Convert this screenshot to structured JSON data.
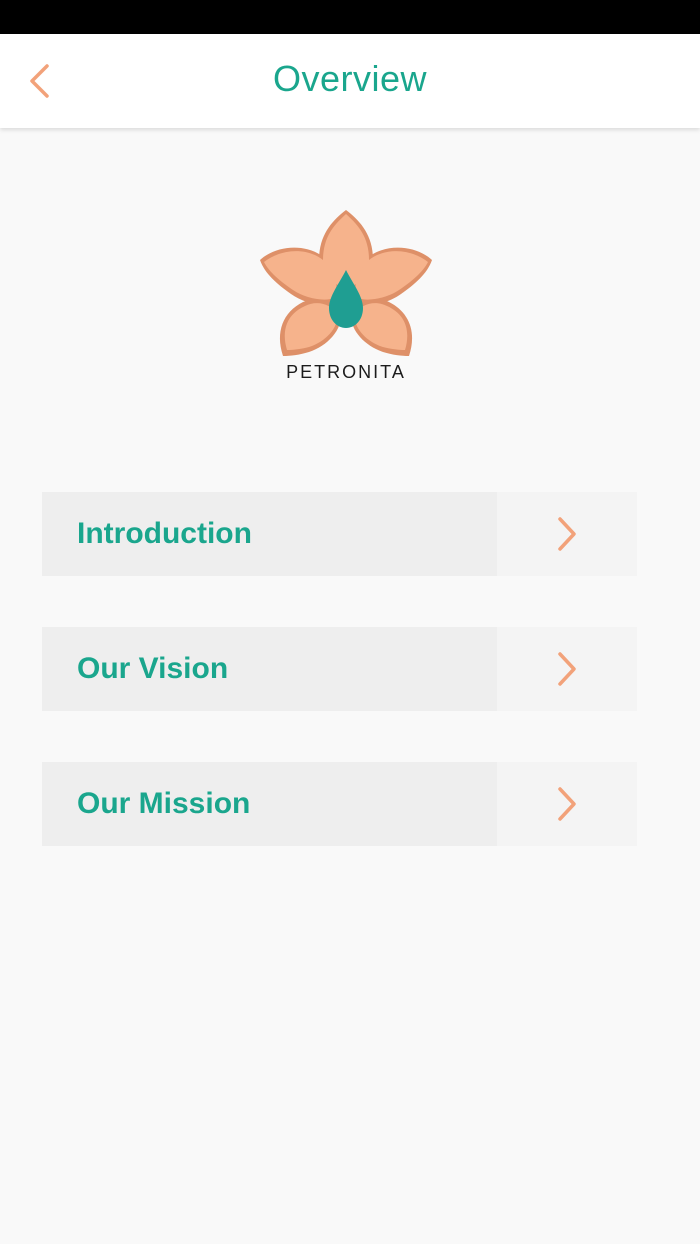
{
  "header": {
    "title": "Overview",
    "back_icon": "chevron-left-icon"
  },
  "logo": {
    "brand_name": "PETRONITA"
  },
  "menu": {
    "items": [
      {
        "label": "Introduction",
        "icon": "chevron-right-icon"
      },
      {
        "label": "Our Vision",
        "icon": "chevron-right-icon"
      },
      {
        "label": "Our Mission",
        "icon": "chevron-right-icon"
      }
    ]
  },
  "colors": {
    "accent_teal": "#1aa68d",
    "accent_orange": "#f2a27a",
    "petal": "#f6b38c",
    "petal_shadow": "#de9068",
    "drop": "#1f9e92",
    "background": "#f9f9f9",
    "row_background": "#eeeeee"
  }
}
